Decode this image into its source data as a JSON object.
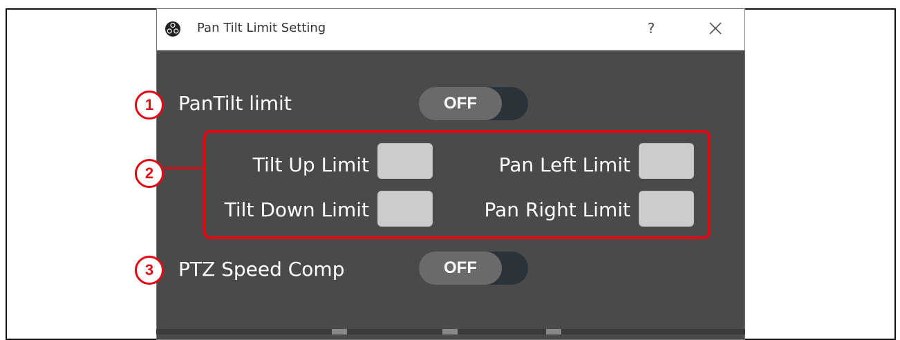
{
  "dialog": {
    "title": "Pan Tilt Limit Setting",
    "help_label": "?",
    "icon": "obs-logo-icon",
    "close_icon": "close-icon"
  },
  "settings": {
    "pantilt_limit": {
      "label": "PanTilt limit",
      "state": "OFF"
    },
    "ptz_speed_comp": {
      "label": "PTZ Speed Comp",
      "state": "OFF"
    }
  },
  "limits": {
    "tilt_up": {
      "label": "Tilt Up Limit",
      "value": ""
    },
    "tilt_down": {
      "label": "Tilt Down Limit",
      "value": ""
    },
    "pan_left": {
      "label": "Pan Left Limit",
      "value": ""
    },
    "pan_right": {
      "label": "Pan Right Limit",
      "value": ""
    }
  },
  "callouts": [
    "1",
    "2",
    "3"
  ],
  "colors": {
    "dialog_bg": "#4a4a4a",
    "callout_red": "#e30613",
    "toggle_track": "#2c3338",
    "toggle_knob": "#6a6a6a",
    "value_box": "#cccccc"
  }
}
